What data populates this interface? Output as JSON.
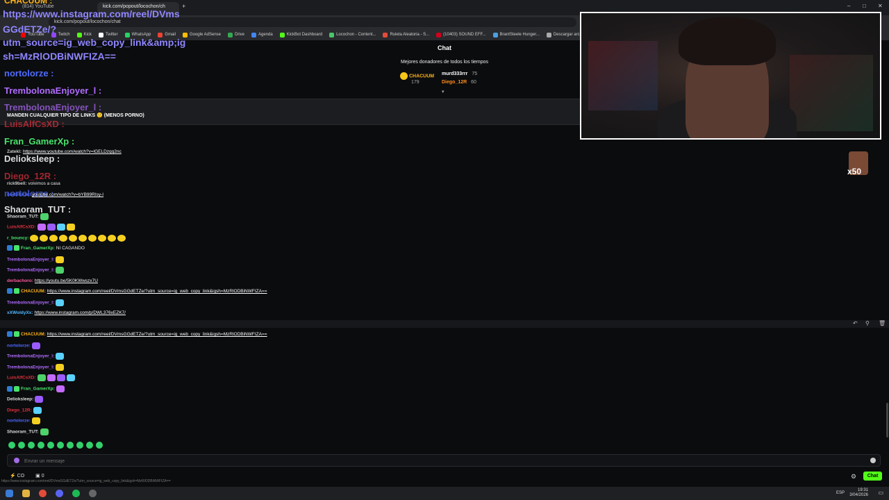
{
  "browser": {
    "tabs": [
      {
        "label": "(814) YouTube"
      },
      {
        "label": "kick.com/popout/locochon/ch"
      }
    ],
    "tab_ghost_text": "CHACUUM :",
    "new_tab": "+",
    "url": "kick.com/popout/locochon/chat",
    "window_controls": {
      "min": "–",
      "max": "□",
      "close": "✕"
    },
    "bookmarks": [
      "YouTube",
      "Twitch",
      "Kick",
      "Twitter",
      "WhatsApp",
      "Gmail",
      "Google AdSense",
      "Drive",
      "Agenda",
      "KickBot Dashboard",
      "Locochon - Content...",
      "Ruleta Aleatoria - S...",
      "(10403) SOUND EFF...",
      "BrantSteele Hunger...",
      "Descargar archivo |"
    ]
  },
  "ghost_overlay": {
    "link_lines": [
      "https://www.instagram.com/reel/DVms",
      "GGdETZe/?",
      "utm_source=ig_web_copy_link&amp;ig",
      "sh=MzRlODBiNWFIZA=="
    ],
    "names": [
      {
        "text": "nortolorze :",
        "color": "#4f6bff"
      },
      {
        "text": "TrembolonaEnjoyer_l :",
        "color": "#b06bff"
      },
      {
        "text": "TrembolonaEnjoyer_l :",
        "color": "#b06bff"
      },
      {
        "text": "LuisAlfCsXD :",
        "color": "#e0313d"
      },
      {
        "text": "Fran_GamerXp :",
        "color": "#49e36a"
      },
      {
        "text": "Delioksleep :",
        "color": "#dddddd"
      },
      {
        "text": "Diego_12R :",
        "color": "#e0313d"
      },
      {
        "text": "nortolorze :",
        "color": "#4f6bff"
      },
      {
        "text": "Shaoram_TUT :",
        "color": "#dddddd"
      }
    ]
  },
  "chat": {
    "header": "Chat",
    "donors_title": "Mejores donadores de todos los tiempos",
    "top_donor": {
      "name": "CHACUUM",
      "amount": "179"
    },
    "donors": [
      {
        "name": "murd333rrr",
        "amount": "75"
      },
      {
        "name": "Diego_12R",
        "amount": "60"
      }
    ],
    "pinned_text": "MANDEN CUALQUIER TIPO DE LINKS 🙂 (MENOS PORNO)",
    "messages": [
      {
        "user": "Zatekl:",
        "color": "#c9c9c9",
        "text": "https://www.youtube.com/watch?v=lGELDzqq2nc",
        "link": true
      },
      {
        "user": "rick9bell:",
        "color": "#c9c9c9",
        "text": "volvimos a casa",
        "link": false
      },
      {
        "user": "nortolorze:",
        "color": "#4f6bff",
        "text": "youtube.com/watch?v=bYB99RIsy-I",
        "link": true
      },
      {
        "user": "Shaoram_TUT:",
        "color": "#dddddd",
        "text": "",
        "link": false
      },
      {
        "user": "LuisAlfCsXD:",
        "color": "#e0313d",
        "text": "",
        "link": false
      },
      {
        "user": "r_bouncy:",
        "color": "#49e36a",
        "text": "",
        "link": false
      },
      {
        "user": "Fran_GamerXp:",
        "color": "#49e36a",
        "text": "NI CAGANDO",
        "link": false
      },
      {
        "user": "TrembolonaEnjoyer_l:",
        "color": "#b06bff",
        "text": "",
        "link": false
      },
      {
        "user": "TrembolonaEnjoyer_l:",
        "color": "#b06bff",
        "text": "",
        "link": false
      },
      {
        "user": "derbachoro:",
        "color": "#ff5a9f",
        "text": "https://youtu.be/5K0KWwszx7U",
        "link": true
      },
      {
        "user": "CHACUUM:",
        "color": "#ffb31a",
        "text": "https://www.instagram.com/reel/DVmsGGdETZe/?utm_source=ig_web_copy_link&igsh=MzRlODBiNWFIZA==",
        "link": true
      },
      {
        "user": "TrembolonaEnjoyer_l:",
        "color": "#b06bff",
        "text": "",
        "link": false
      },
      {
        "user": "xXWoldyXx:",
        "color": "#4fb8ff",
        "text": "https://www.instagram.com/p/DWL376xEZK7/",
        "link": true
      },
      {
        "user": "CHACUUM:",
        "color": "#ffb31a",
        "text": "https://www.instagram.com/reel/DVmsGGdETZe/?utm_source=ig_web_copy_link&igsh=MzRlODBiNWFIZA==",
        "link": true
      },
      {
        "user": "CHACUUM:",
        "color": "#ffb31a",
        "text": "https://www.instagram.com/reel/DVmsGGdETZe/?utm_source=ig_web_copy_link&igsh=MzRlODBiNWFIZA==",
        "link": true
      },
      {
        "user": "nortolorze:",
        "color": "#4f6bff",
        "text": "",
        "link": false
      },
      {
        "user": "TrembolonaEnjoyer_l:",
        "color": "#b06bff",
        "text": "",
        "link": false
      },
      {
        "user": "TrembolonaEnjoyer_l:",
        "color": "#b06bff",
        "text": "",
        "link": false
      },
      {
        "user": "LuisAlfCsXD:",
        "color": "#e0313d",
        "text": "",
        "link": false
      },
      {
        "user": "Fran_GamerXp:",
        "color": "#49e36a",
        "text": "",
        "link": false
      },
      {
        "user": "Delioksleep:",
        "color": "#dddddd",
        "text": "",
        "link": false
      },
      {
        "user": "Diego_12R:",
        "color": "#e0313d",
        "text": "",
        "link": false
      },
      {
        "user": "nortolorze:",
        "color": "#4f6bff",
        "text": "",
        "link": false
      },
      {
        "user": "Shaoram_TUT:",
        "color": "#dddddd",
        "text": "",
        "link": false
      }
    ],
    "input_placeholder": "Enviar un mensaje",
    "footer": {
      "points": "CO",
      "count": "0"
    },
    "chat_button": "Chat",
    "sub_gift": "x50",
    "status_url": "https://www.instagram.com/reel/DVmsGGdETZe/?utm_source=ig_web_copy_link&igsh=MzRlODBiNWFIZA=="
  },
  "taskbar": {
    "lang": "ESP",
    "time": "19:31",
    "date": "3/04/2026"
  },
  "colors": {
    "kick_green": "#53fc18",
    "background": "#0b0c0e"
  }
}
